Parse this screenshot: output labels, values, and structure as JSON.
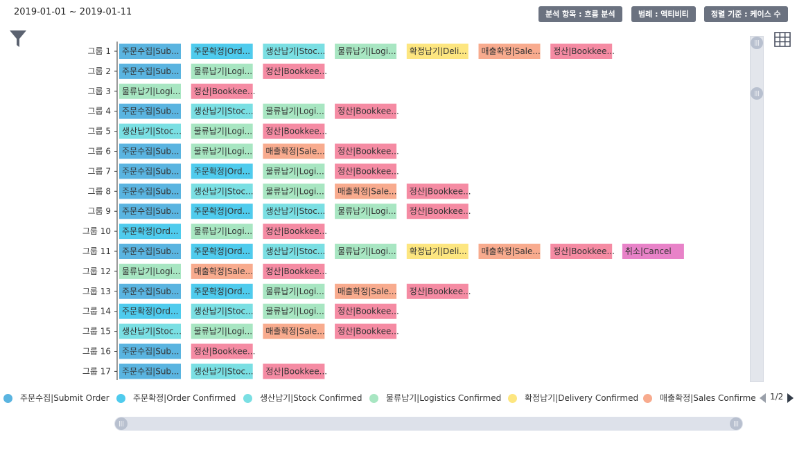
{
  "header": {
    "date_range": "2019-01-01 ~ 2019-01-11",
    "buttons": [
      "분석 항목 : 흐름 분석",
      "범례 : 액티비티",
      "정렬 기준 : 케이스 수"
    ]
  },
  "icons": {
    "filter": "filter-icon",
    "grid": "grid-view-icon"
  },
  "colors": {
    "submit": "#5ab4e0",
    "order": "#4fcbed",
    "stock": "#7adfe3",
    "logistics": "#a8e6c2",
    "delivery": "#fde680",
    "sales": "#f8ab8e",
    "bookkeeping": "#f58ba3",
    "cancel": "#e882c8"
  },
  "chart_data": {
    "type": "table",
    "activities": [
      {
        "key": "submit",
        "full": "주문수집|Submit Order",
        "short": "주문수집|Sub..."
      },
      {
        "key": "order",
        "full": "주문확정|Order Confirmed",
        "short": "주문확정|Ord..."
      },
      {
        "key": "stock",
        "full": "생산납기|Stock Confirmed",
        "short": "생산납기|Stoc..."
      },
      {
        "key": "logistics",
        "full": "물류납기|Logistics Confirmed",
        "short": "물류납기|Logi..."
      },
      {
        "key": "delivery",
        "full": "확정납기|Delivery Confirmed",
        "short": "확정납기|Deli..."
      },
      {
        "key": "sales",
        "full": "매출확정|Sales Confirmed",
        "short": "매출확정|Sale..."
      },
      {
        "key": "bookkeeping",
        "full": "정산|Bookkeeping",
        "short": "정산|Bookkee..."
      },
      {
        "key": "cancel",
        "full": "취소|Cancel",
        "short": "취소|Cancel"
      }
    ],
    "groups": [
      {
        "label": "그룹 1",
        "sequence": [
          "submit",
          "order",
          "stock",
          "logistics",
          "delivery",
          "sales",
          "bookkeeping"
        ]
      },
      {
        "label": "그룹 2",
        "sequence": [
          "submit",
          "logistics",
          "bookkeeping"
        ]
      },
      {
        "label": "그룹 3",
        "sequence": [
          "logistics",
          "bookkeeping"
        ]
      },
      {
        "label": "그룹 4",
        "sequence": [
          "submit",
          "stock",
          "logistics",
          "bookkeeping"
        ]
      },
      {
        "label": "그룹 5",
        "sequence": [
          "stock",
          "logistics",
          "bookkeeping"
        ]
      },
      {
        "label": "그룹 6",
        "sequence": [
          "submit",
          "logistics",
          "sales",
          "bookkeeping"
        ]
      },
      {
        "label": "그룹 7",
        "sequence": [
          "submit",
          "order",
          "logistics",
          "bookkeeping"
        ]
      },
      {
        "label": "그룹 8",
        "sequence": [
          "submit",
          "stock",
          "logistics",
          "sales",
          "bookkeeping"
        ]
      },
      {
        "label": "그룹 9",
        "sequence": [
          "submit",
          "order",
          "stock",
          "logistics",
          "bookkeeping"
        ]
      },
      {
        "label": "그룹 10",
        "sequence": [
          "order",
          "logistics",
          "bookkeeping"
        ]
      },
      {
        "label": "그룹 11",
        "sequence": [
          "submit",
          "order",
          "stock",
          "logistics",
          "delivery",
          "sales",
          "bookkeeping",
          "cancel"
        ]
      },
      {
        "label": "그룹 12",
        "sequence": [
          "logistics",
          "sales",
          "bookkeeping"
        ]
      },
      {
        "label": "그룹 13",
        "sequence": [
          "submit",
          "order",
          "logistics",
          "sales",
          "bookkeeping"
        ]
      },
      {
        "label": "그룹 14",
        "sequence": [
          "order",
          "stock",
          "logistics",
          "bookkeeping"
        ]
      },
      {
        "label": "그룹 15",
        "sequence": [
          "stock",
          "logistics",
          "sales",
          "bookkeeping"
        ]
      },
      {
        "label": "그룹 16",
        "sequence": [
          "submit",
          "bookkeeping"
        ]
      },
      {
        "label": "그룹 17",
        "sequence": [
          "submit",
          "stock",
          "bookkeeping"
        ]
      }
    ],
    "legend_position": "bottom"
  },
  "legend": {
    "items": [
      {
        "label": "주문수집|Submit Order",
        "key": "submit"
      },
      {
        "label": "주문확정|Order Confirmed",
        "key": "order"
      },
      {
        "label": "생산납기|Stock Confirmed",
        "key": "stock"
      },
      {
        "label": "물류납기|Logistics Confirmed",
        "key": "logistics"
      },
      {
        "label": "확정납기|Delivery Confirmed",
        "key": "delivery"
      },
      {
        "label": "매출확정|Sales Confirmed",
        "key": "sales"
      }
    ],
    "page": "1/2"
  }
}
